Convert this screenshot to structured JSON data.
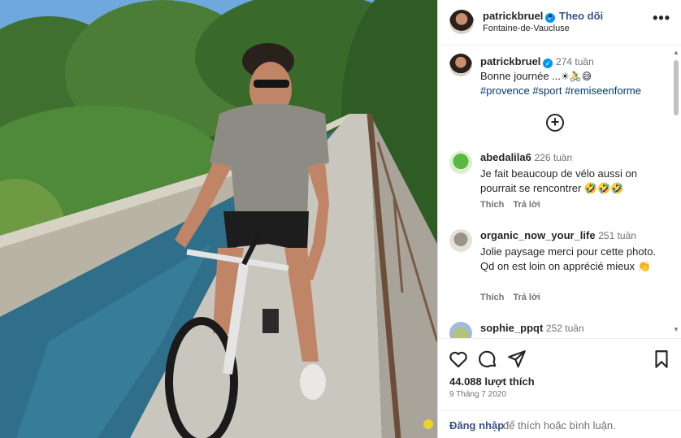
{
  "post": {
    "username": "patrickbruel",
    "follow_separator": "•",
    "follow_label": "Theo dõi",
    "location": "Fontaine-de-Vaucluse",
    "more_label": "•••",
    "verified_glyph": "✓"
  },
  "caption": {
    "username": "patrickbruel",
    "time": "274 tuần",
    "text": "Bonne journée ...",
    "emojis": "☀🚴😅",
    "hashtags": "#provence #sport #remiseenforme"
  },
  "load_more_label": "+",
  "comments": [
    {
      "username": "abedalila6",
      "time": "226 tuần",
      "text": "Je fait beaucoup de vélo aussi on pourrait se rencontrer 🤣🤣🤣",
      "like_label": "Thích",
      "reply_label": "Trả lời"
    },
    {
      "username": "organic_now_your_life",
      "time": "251 tuần",
      "text": "Jolie paysage merci pour cette photo. Qd on est loin on apprécié mieux 👏",
      "like_label": "Thích",
      "reply_label": "Trả lời"
    },
    {
      "username": "sophie_ppqt",
      "time": "252 tuần"
    }
  ],
  "actions": {
    "likes": "44.088 lượt thích",
    "date": "9 Tháng 7 2020",
    "login_link": "Đăng nhập",
    "login_rest": "để thích hoặc bình luận."
  },
  "scrollbar": {
    "up": "▲",
    "down": "▼"
  },
  "colors": {
    "link": "#385185",
    "hashtag": "#00376b",
    "verified": "#0095f6",
    "muted": "#737373"
  }
}
